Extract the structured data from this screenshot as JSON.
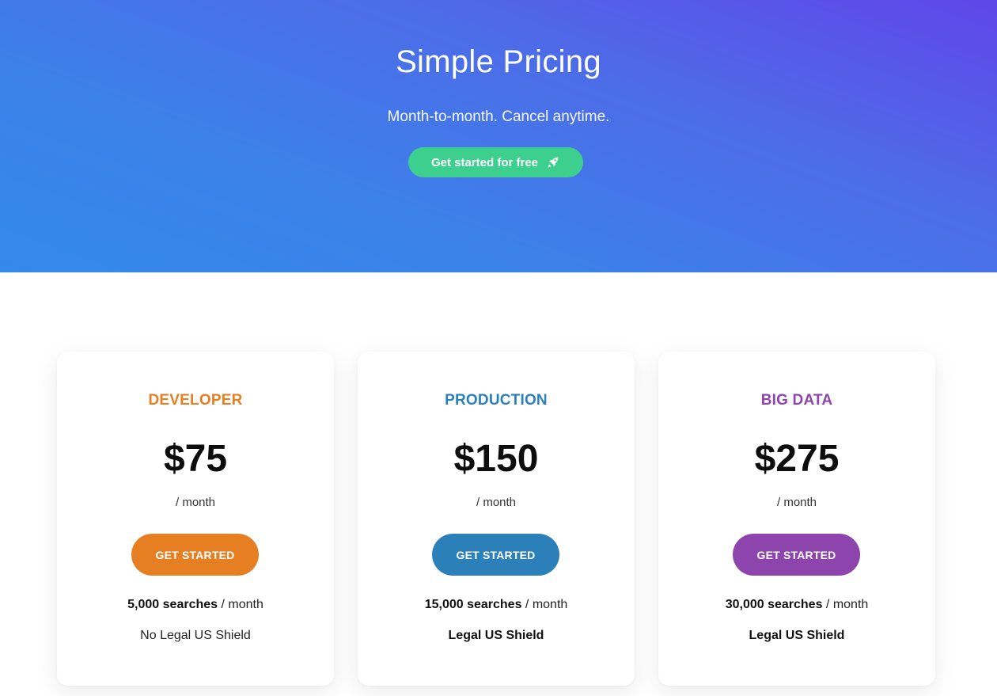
{
  "hero": {
    "title": "Simple Pricing",
    "subtitle": "Month-to-month. Cancel anytime.",
    "cta_label": "Get started for free",
    "cta_icon": "rocket-icon",
    "cta_color": "#3ccf8e"
  },
  "plans": [
    {
      "name": "DEVELOPER",
      "color": "#e67e22",
      "price": "$75",
      "period": "/ month",
      "button_label": "GET STARTED",
      "searches": "5,000 searches",
      "searches_period": " / month",
      "shield": "No Legal US Shield"
    },
    {
      "name": "PRODUCTION",
      "color": "#2c80b9",
      "price": "$150",
      "period": "/ month",
      "button_label": "GET STARTED",
      "searches": "15,000 searches",
      "searches_period": " / month",
      "shield": "Legal US Shield"
    },
    {
      "name": "BIG DATA",
      "color": "#8e44ad",
      "price": "$275",
      "period": "/ month",
      "button_label": "GET STARTED",
      "searches": "30,000 searches",
      "searches_period": " / month",
      "shield": "Legal US Shield"
    }
  ]
}
